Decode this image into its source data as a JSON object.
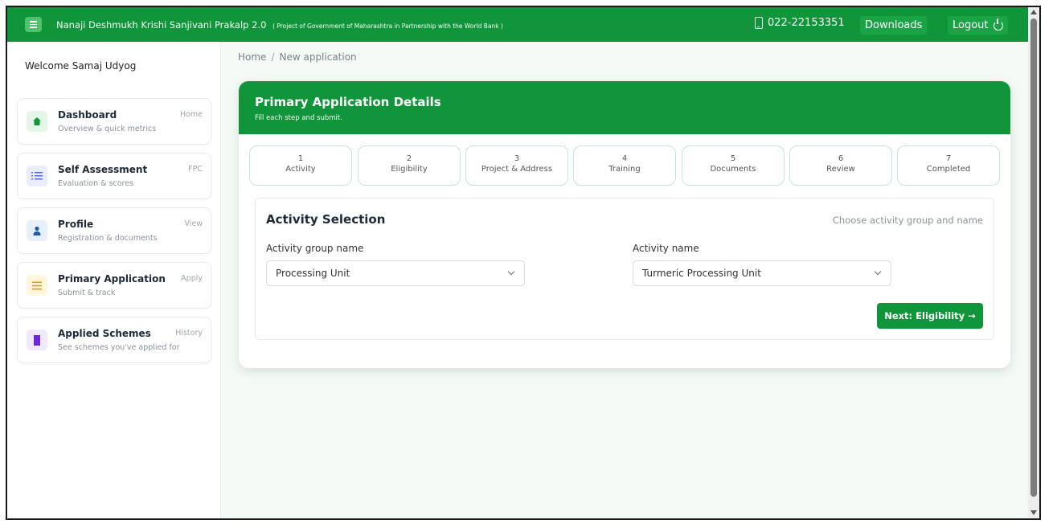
{
  "header": {
    "menu_icon": "hamburger-icon",
    "title": "Nanaji Deshmukh Krishi Sanjivani Prakalp 2.0",
    "subtitle": "( Project of Government of Maharashtra in Partnership with the World Bank )",
    "phone": "022-22153351",
    "phone_icon": "phone-icon",
    "downloads_label": "Downloads",
    "logout_label": "Logout",
    "logout_icon": "power-icon",
    "colors": {
      "primary_green": "#11953a",
      "button_green": "#1aa446",
      "background": "#f4fbf6"
    }
  },
  "sidebar": {
    "welcome": "Welcome Samaj Udyog",
    "items": [
      {
        "title": "Dashboard",
        "subtitle": "Overview & quick metrics",
        "tag": "Home",
        "icon": "home-icon",
        "icon_color": "#11953a",
        "icon_bg": "#e3f6e8"
      },
      {
        "title": "Self Assessment",
        "subtitle": "Evaluation & scores",
        "tag": "FPC",
        "icon": "list-icon",
        "icon_color": "#4a6cf7",
        "icon_bg": "#e9edff"
      },
      {
        "title": "Profile",
        "subtitle": "Registration & documents",
        "tag": "View",
        "icon": "user-icon",
        "icon_color": "#1e5aa8",
        "icon_bg": "#e6f0fb"
      },
      {
        "title": "Primary Application",
        "subtitle": "Submit & track",
        "tag": "Apply",
        "icon": "menu-lines-icon",
        "icon_color": "#e0a100",
        "icon_bg": "#fff6dc"
      },
      {
        "title": "Applied Schemes",
        "subtitle": "See schemes you've applied for",
        "tag": "History",
        "icon": "bookmark-icon",
        "icon_color": "#6d28d9",
        "icon_bg": "#f1e9ff"
      }
    ]
  },
  "breadcrumb": {
    "home": "Home",
    "separator": "/",
    "current": "New application"
  },
  "panel": {
    "title": "Primary Application Details",
    "subtitle": "Fill each step and submit.",
    "steps": [
      {
        "number": "1",
        "label": "Activity"
      },
      {
        "number": "2",
        "label": "Eligibility"
      },
      {
        "number": "3",
        "label": "Project & Address"
      },
      {
        "number": "4",
        "label": "Training"
      },
      {
        "number": "5",
        "label": "Documents"
      },
      {
        "number": "6",
        "label": "Review"
      },
      {
        "number": "7",
        "label": "Completed"
      }
    ]
  },
  "activity": {
    "title": "Activity Selection",
    "hint": "Choose activity group and name",
    "group_label": "Activity group name",
    "group_value": "Processing Unit",
    "name_label": "Activity name",
    "name_value": "Turmeric Processing Unit",
    "next_label": "Next: Eligibility →"
  }
}
